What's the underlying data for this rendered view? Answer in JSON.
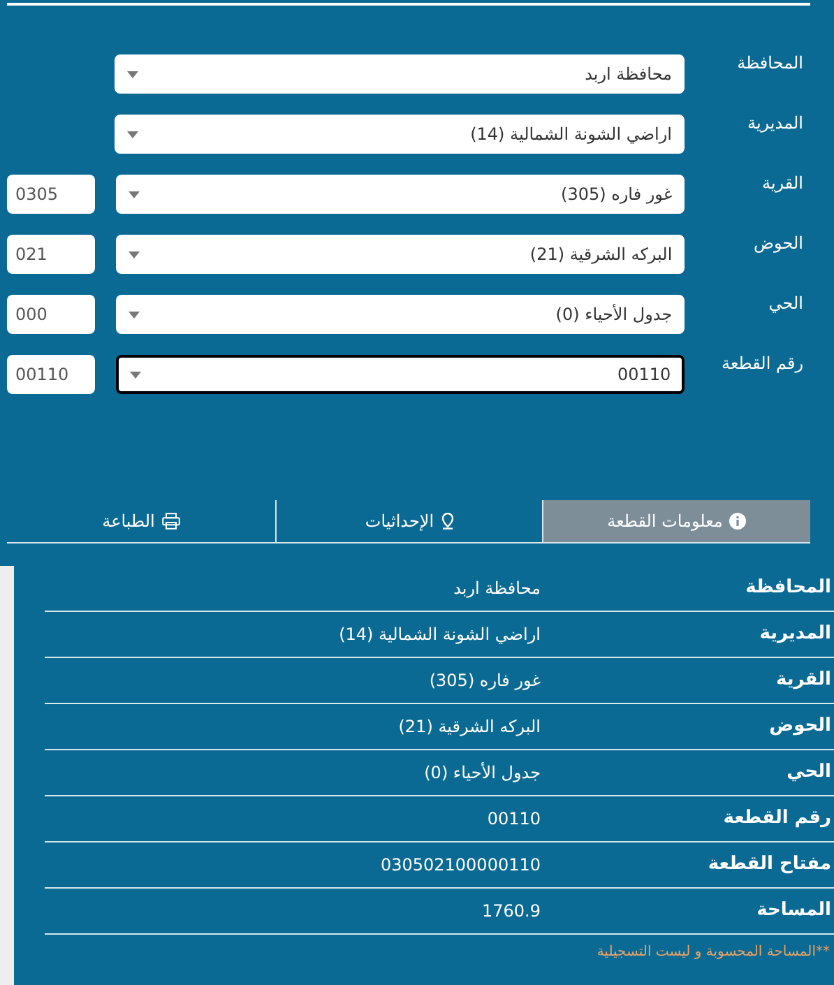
{
  "form": {
    "fields": [
      {
        "label": "المحافظة",
        "value": "محافظة اربد",
        "focused": false
      },
      {
        "label": "المديرية",
        "value": "اراضي الشونة الشمالية (14)",
        "focused": false
      },
      {
        "label": "القرية",
        "value": "غور فاره (305)",
        "code": "0305",
        "focused": false
      },
      {
        "label": "الحوض",
        "value": "البركه الشرقية (21)",
        "code": "021",
        "focused": false
      },
      {
        "label": "الحي",
        "value": "جدول الأحياء (0)",
        "code": "000",
        "focused": false
      },
      {
        "label": "رقم القطعة",
        "value": "00110",
        "code": "00110",
        "focused": true
      }
    ]
  },
  "tabs": [
    {
      "label": "معلومات القطعة",
      "kind": "info",
      "selected": true
    },
    {
      "label": "الإحداثيات",
      "kind": "location",
      "selected": false
    },
    {
      "label": "الطباعة",
      "kind": "print",
      "selected": false
    }
  ],
  "details": {
    "rows": [
      {
        "label": "المحافظة",
        "value": "محافظة اربد"
      },
      {
        "label": "المديرية",
        "value": "اراضي الشونة الشمالية (14)"
      },
      {
        "label": "القرية",
        "value": "غور فاره (305)"
      },
      {
        "label": "الحوض",
        "value": "البركه الشرقية (21)"
      },
      {
        "label": "الحي",
        "value": "جدول الأحياء (0)"
      },
      {
        "label": "رقم القطعة",
        "value": "00110"
      },
      {
        "label": "مفتاح القطعة",
        "value": "030502100000110"
      },
      {
        "label": "المساحة",
        "value": "1760.9"
      }
    ],
    "note": "**المساحة المحسوبة و ليست التسجيلية"
  }
}
